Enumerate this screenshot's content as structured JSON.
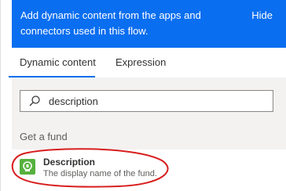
{
  "banner": {
    "message": "Add dynamic content from the apps and connectors used in this flow.",
    "hide_label": "Hide"
  },
  "tabs": [
    {
      "label": "Dynamic content",
      "active": true
    },
    {
      "label": "Expression",
      "active": false
    }
  ],
  "search": {
    "value": "description",
    "icon": "search-icon"
  },
  "section": {
    "title": "Get a fund"
  },
  "results": [
    {
      "title": "Description",
      "description": "The display name of the fund.",
      "icon": "connector-icon",
      "icon_color": "#56b13d"
    }
  ],
  "colors": {
    "accent": "#0a6ef0",
    "annotation": "#d81e1e"
  }
}
